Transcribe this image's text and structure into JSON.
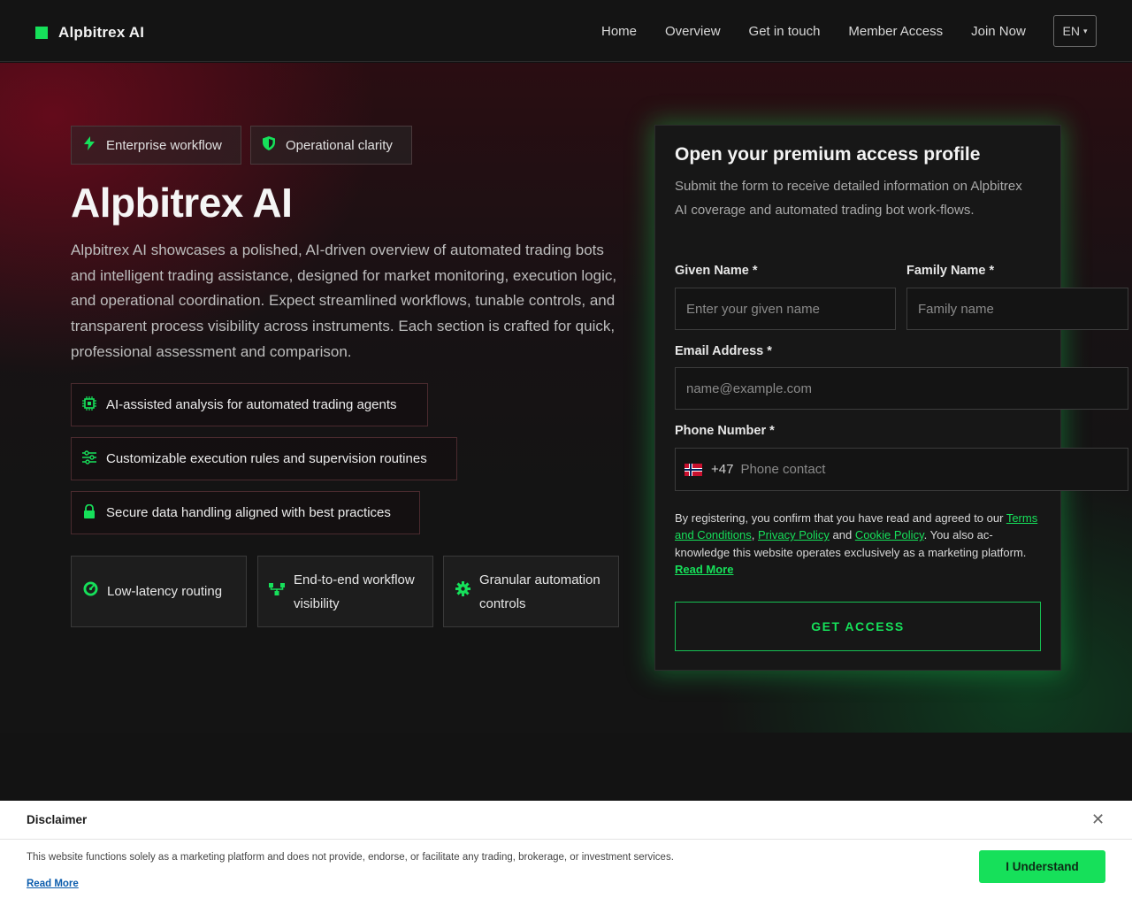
{
  "header": {
    "brand": "Alpbitrex AI",
    "nav": [
      "Home",
      "Overview",
      "Get in touch",
      "Member Access",
      "Join Now"
    ],
    "language": "EN"
  },
  "hero": {
    "chips": [
      {
        "label": "Enterprise workflow",
        "icon": "lightning-icon"
      },
      {
        "label": "Operational clarity",
        "icon": "shield-icon"
      }
    ],
    "title": "Alpbitrex AI",
    "description": "Alpbitrex AI showcases a polished, AI-driven overview of automated trading bots and intelligent trading assistance, designed for market monitoring, execution logic, and operational coordination. Expect streamlined workflows, tunable controls, and transparent process visibility across instruments. Each section is crafted for quick, professional assessment and comparison.",
    "features": [
      {
        "label": "AI-assisted analysis for automated trading agents",
        "icon": "chip-icon"
      },
      {
        "label": "Customizable execution rules and supervision routines",
        "icon": "sliders-icon"
      },
      {
        "label": "Secure data handling aligned with best practices",
        "icon": "lock-icon"
      }
    ],
    "tiles": [
      {
        "label": "Low-latency routing",
        "icon": "gauge-icon"
      },
      {
        "label": "End-to-end workflow visibility",
        "icon": "network-icon"
      },
      {
        "label": "Granular automation controls",
        "icon": "gear-icon"
      }
    ]
  },
  "form": {
    "title": "Open your premium access profile",
    "subtitle": "Submit the form to receive detailed information on Alpbitrex AI coverage and automated trading bot work-flows.",
    "given_name_label": "Given Name *",
    "given_name_placeholder": "Enter your given name",
    "family_name_label": "Family Name *",
    "family_name_placeholder": "Family name",
    "email_label": "Email Address *",
    "email_placeholder": "name@example.com",
    "phone_label": "Phone Number *",
    "phone_dial_code": "+47",
    "phone_placeholder": "Phone contact",
    "consent_prefix": "By registering, you confirm that you have read and agreed to our ",
    "terms_link": "Terms and Conditions",
    "comma": ", ",
    "privacy_link": "Privacy Policy",
    "and": " and ",
    "cookie_link": "Cookie Policy",
    "consent_suffix": ". You also ac-knowledge this website operates exclusively as a marketing platform.",
    "read_more": "Read More",
    "submit": "GET ACCESS"
  },
  "disclaimer": {
    "title": "Disclaimer",
    "text": "This website functions solely as a marketing platform and does not provide, endorse, or facilitate any trading, brokerage, or investment services.",
    "read_more": "Read More",
    "button": "I Understand"
  },
  "colors": {
    "accent": "#16e05a",
    "background": "#121212",
    "link_blue": "#0b5cad"
  }
}
